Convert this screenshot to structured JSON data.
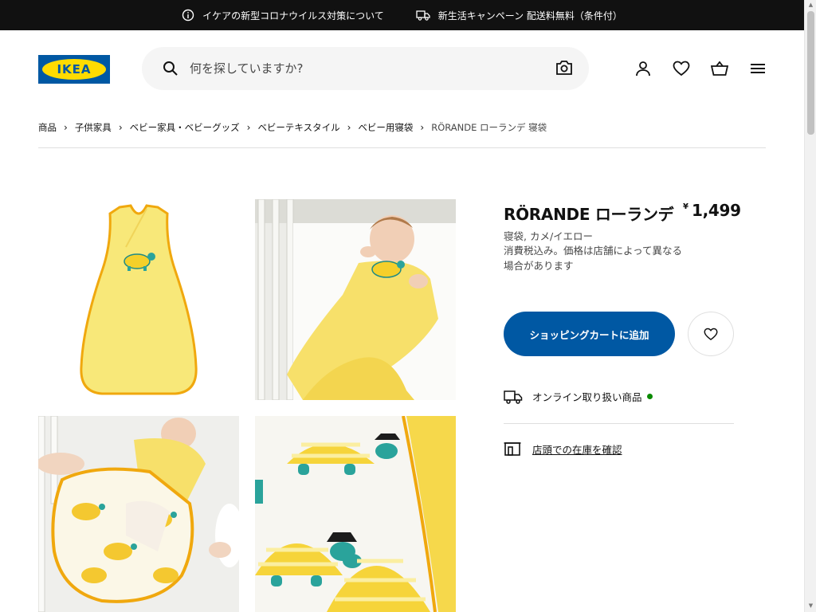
{
  "topbar": {
    "notice1": "イケアの新型コロナウイルス対策について",
    "notice2": "新生活キャンペーン 配送料無料（条件付）"
  },
  "header": {
    "logo_text": "IKEA",
    "search_placeholder": "何を探していますか?"
  },
  "breadcrumb": [
    "商品",
    "子供家具",
    "ベビー家具・ベビーグッズ",
    "ベビーテキスタイル",
    "ベビー用寝袋",
    "RÖRANDE ローランデ 寝袋"
  ],
  "product": {
    "name": "RÖRANDE ローランデ",
    "currency": "¥",
    "price": "1,499",
    "description": "寝袋, カメ/イエロー",
    "note": "消費税込み。価格は店舗によって異なる場合があります",
    "add_to_cart": "ショッピングカートに追加",
    "online_label": "オンライン取り扱い商品",
    "store_label": "店頭での在庫を確認"
  },
  "colors": {
    "brand_blue": "#0058a3",
    "brand_yellow": "#ffdb00",
    "available_green": "#0a8a00"
  }
}
